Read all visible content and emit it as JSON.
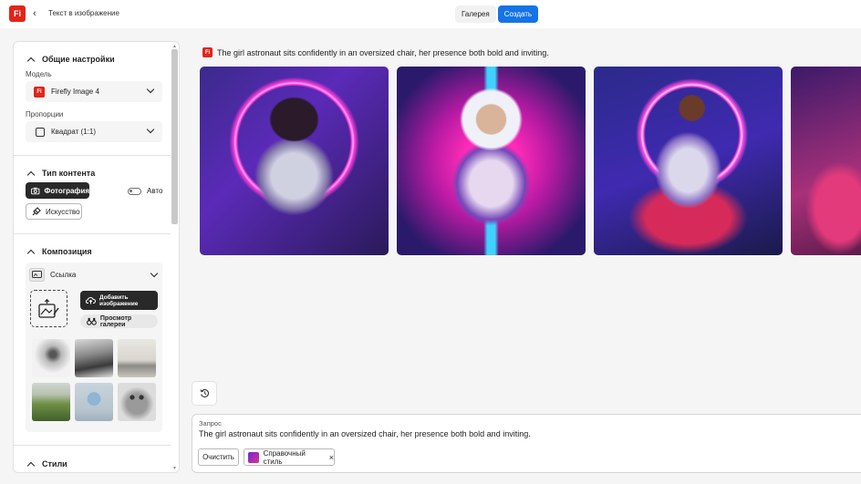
{
  "app": {
    "logo_text": "Fi",
    "back_icon": "chevron-left-icon",
    "title": "Текст в изображение"
  },
  "header": {
    "gallery_label": "Галерея",
    "create_label": "Создать",
    "accent": "#1473e6"
  },
  "panel": {
    "general": {
      "heading": "Общие настройки",
      "model_label": "Модель",
      "model_value": "Firefly Image 4",
      "aspect_label": "Пропорции",
      "aspect_value": "Квадрат (1:1)"
    },
    "content_type": {
      "heading": "Тип контента",
      "photo_label": "Фотография",
      "auto_label": "Авто",
      "art_label": "Искусство"
    },
    "composition": {
      "heading": "Композиция",
      "ref_label": "Ссылка",
      "add_image_label": "Добавить изображение",
      "browse_label": "Просмотр галереи",
      "thumbnails": [
        "bird-sketch",
        "mountain-mist",
        "living-room",
        "green-field",
        "sphere-on-pedestal",
        "owl-sketch"
      ]
    },
    "styles": {
      "heading": "Стили"
    }
  },
  "result": {
    "prompt_text": "The girl astronaut sits confidently in an oversized chair, her presence both bold and inviting.",
    "images": [
      "astronaut-1",
      "astronaut-2",
      "astronaut-3",
      "astronaut-4"
    ]
  },
  "prompt_bar": {
    "label": "Запрос",
    "text": "The girl astronaut sits confidently in an oversized chair, her presence both bold and inviting.",
    "clear_label": "Очистить",
    "style_chip_label": "Справочный стиль",
    "remove_icon": "close-icon"
  }
}
